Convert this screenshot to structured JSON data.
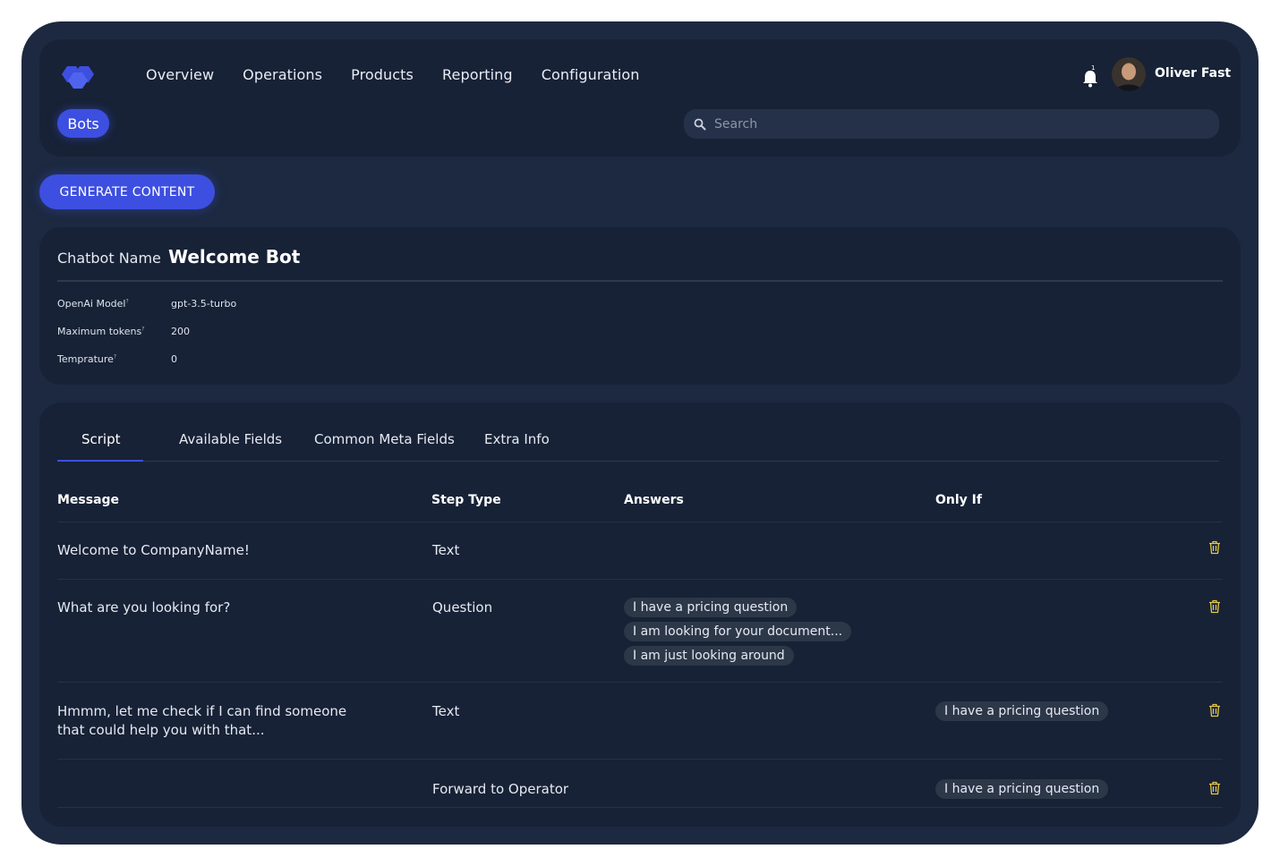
{
  "nav": {
    "items": [
      "Overview",
      "Operations",
      "Products",
      "Reporting",
      "Configuration"
    ]
  },
  "notifications": {
    "count": "1"
  },
  "user": {
    "name": "Oliver Fast"
  },
  "subnav": {
    "active": "Bots"
  },
  "search": {
    "placeholder": "Search"
  },
  "actions": {
    "generate_label": "GENERATE CONTENT"
  },
  "bot": {
    "name_label": "Chatbot Name",
    "name_value": "Welcome Bot",
    "params": [
      {
        "label": "OpenAi Model",
        "value": "gpt-3.5-turbo"
      },
      {
        "label": "Maximum tokens",
        "value": "200"
      },
      {
        "label": "Temprature",
        "value": "0"
      }
    ],
    "help_mark": "?"
  },
  "tabs": [
    "Script",
    "Available Fields",
    "Common Meta Fields",
    "Extra Info"
  ],
  "table": {
    "headers": [
      "Message",
      "Step Type",
      "Answers",
      "Only If"
    ],
    "rows": [
      {
        "message": "Welcome to CompanyName!",
        "step_type": "Text",
        "answers": [],
        "only_if": ""
      },
      {
        "message": "What are you looking for?",
        "step_type": "Question",
        "answers": [
          "I have a pricing question",
          "I am looking for your document...",
          "I am just looking around"
        ],
        "only_if": ""
      },
      {
        "message": "Hmmm, let me check if I can find someone that could help you with that...",
        "step_type": "Text",
        "answers": [],
        "only_if": "I have a pricing question"
      },
      {
        "message": "",
        "step_type": "Forward to Operator",
        "answers": [],
        "only_if": "I have a pricing question"
      }
    ]
  },
  "colors": {
    "accent": "#3d4fe0",
    "background": "#1c2940",
    "card": "#172236",
    "trash": "#e3c84a"
  }
}
